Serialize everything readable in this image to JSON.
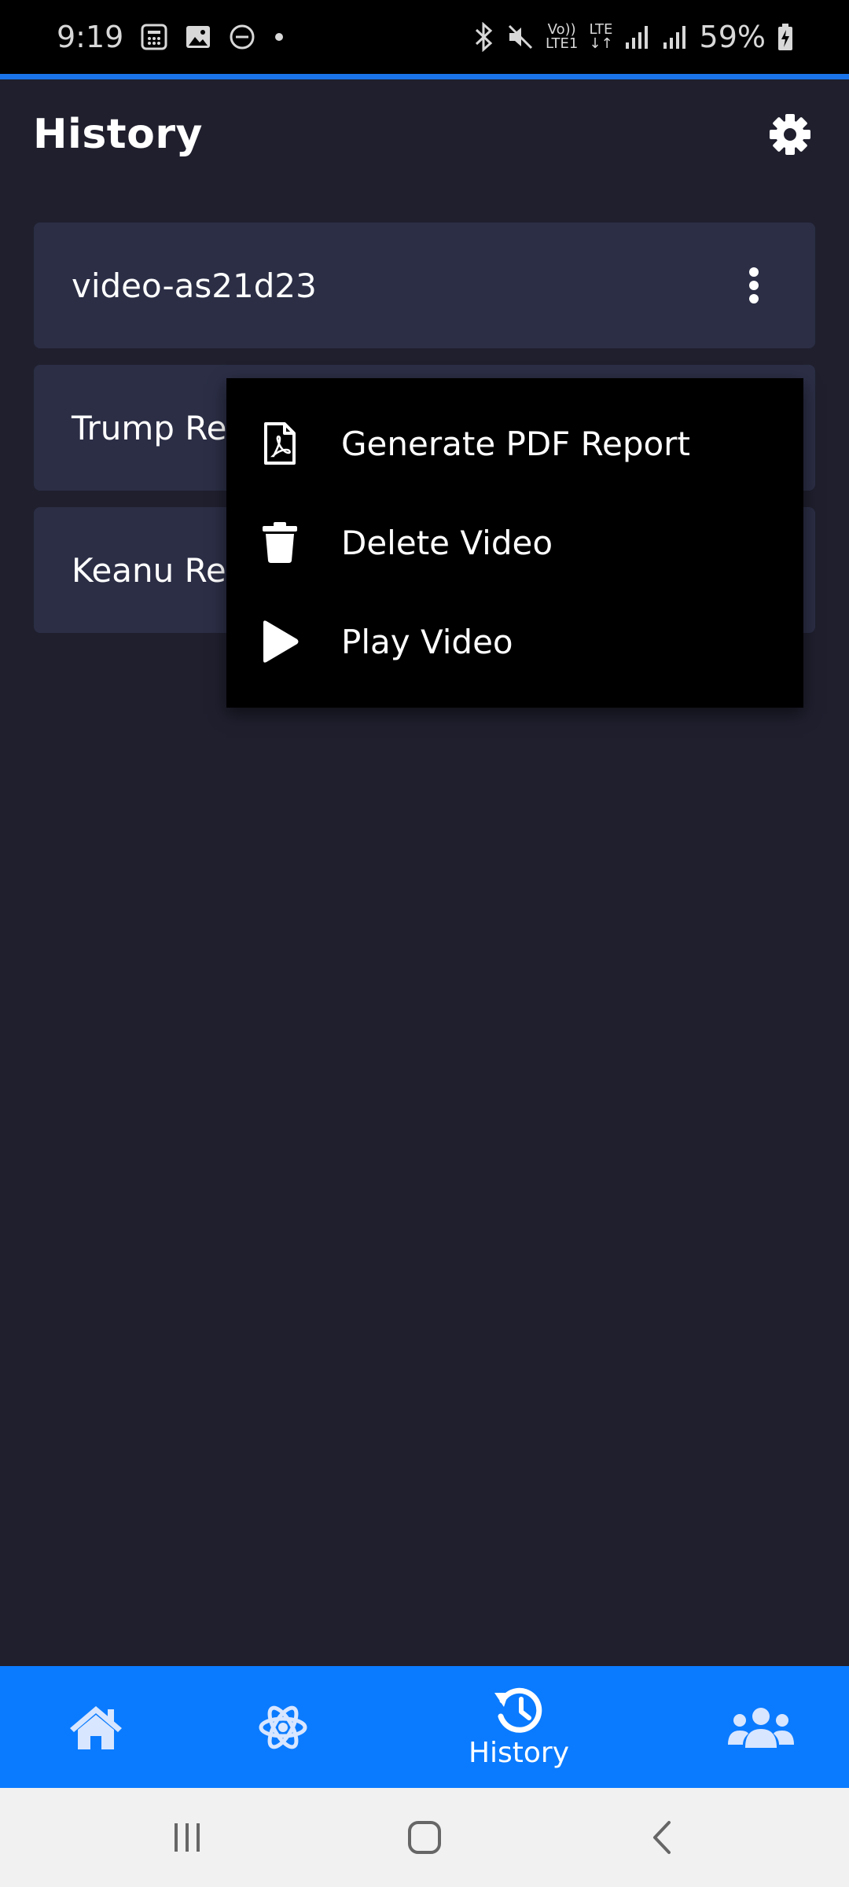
{
  "status_bar": {
    "time": "9:19",
    "volte": "Vo))",
    "lte_sub": "LTE1",
    "lte": "LTE",
    "battery": "59%"
  },
  "header": {
    "title": "History"
  },
  "videos": [
    {
      "name": "video-as21d23"
    },
    {
      "name": "Trump Re"
    },
    {
      "name": "Keanu Re"
    }
  ],
  "menu": {
    "items": [
      {
        "label": "Generate PDF Report",
        "icon": "file-pdf-icon"
      },
      {
        "label": "Delete Video",
        "icon": "trash-icon"
      },
      {
        "label": "Play Video",
        "icon": "play-icon"
      }
    ]
  },
  "bottom_nav": {
    "items": [
      {
        "icon": "home-icon",
        "label": ""
      },
      {
        "icon": "atom-icon",
        "label": ""
      },
      {
        "icon": "history-icon",
        "label": "History",
        "active": true
      },
      {
        "icon": "users-icon",
        "label": ""
      }
    ]
  },
  "colors": {
    "background": "#1f1f2e",
    "card": "#2b2e45",
    "accent": "#0a7bff",
    "menu": "#000000"
  }
}
